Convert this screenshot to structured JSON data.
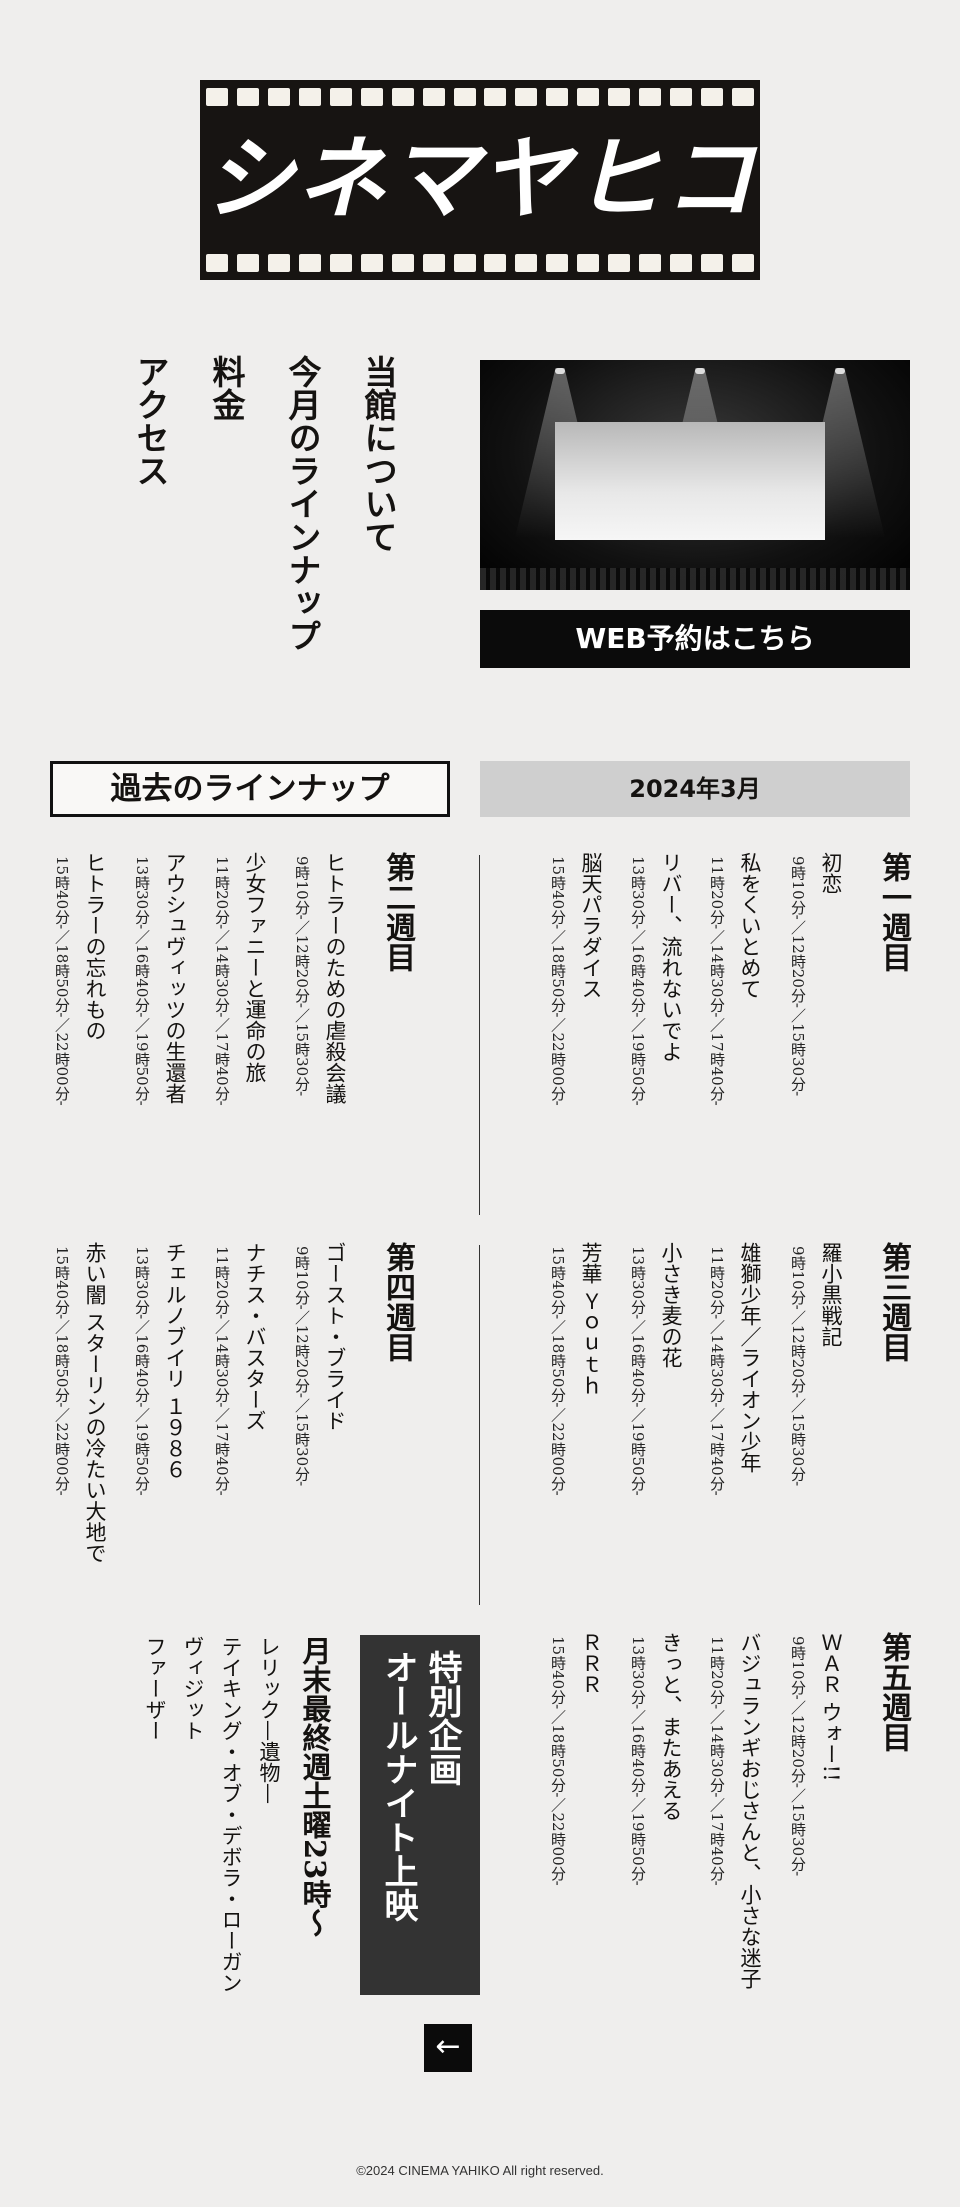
{
  "logo": {
    "text": "シネマヤヒコ"
  },
  "nav": {
    "items": [
      "当館について",
      "今月のラインナップ",
      "料金",
      "アクセス"
    ]
  },
  "reserve": {
    "label": "WEB予約はこちら"
  },
  "lineup": {
    "title": "過去のラインナップ",
    "month": "2024年3月",
    "weeks": [
      {
        "title": "第一週目",
        "films": [
          {
            "title": "初恋",
            "times": "9時10分-／12時20分-／15時30分-"
          },
          {
            "title": "私をくいとめて",
            "times": "11時20分-／14時30分-／17時40分-"
          },
          {
            "title": "リバー、流れないでよ",
            "times": "13時30分-／16時40分-／19時50分-"
          },
          {
            "title": "脳天パラダイス",
            "times": "15時40分-／18時50分-／22時00分-"
          }
        ]
      },
      {
        "title": "第二週目",
        "films": [
          {
            "title": "ヒトラーのための虐殺会議",
            "times": "9時10分-／12時20分-／15時30分-"
          },
          {
            "title": "少女ファニーと運命の旅",
            "times": "11時20分-／14時30分-／17時40分-"
          },
          {
            "title": "アウシュヴィッツの生還者",
            "times": "13時30分-／16時40分-／19時50分-"
          },
          {
            "title": "ヒトラーの忘れもの",
            "times": "15時40分-／18時50分-／22時00分-"
          }
        ]
      },
      {
        "title": "第三週目",
        "films": [
          {
            "title": "羅小黒戦記",
            "times": "9時10分-／12時20分-／15時30分-"
          },
          {
            "title": "雄獅少年／ライオン少年",
            "times": "11時20分-／14時30分-／17時40分-"
          },
          {
            "title": "小さき麦の花",
            "times": "13時30分-／16時40分-／19時50分-"
          },
          {
            "title": "芳華 Ｙｏｕｔｈ",
            "times": "15時40分-／18時50分-／22時00分-"
          }
        ]
      },
      {
        "title": "第四週目",
        "films": [
          {
            "title": "ゴースト・ブライド",
            "times": "9時10分-／12時20分-／15時30分-"
          },
          {
            "title": "ナチス・バスターズ",
            "times": "11時20分-／14時30分-／17時40分-"
          },
          {
            "title": "チェルノブイリ １９８６",
            "times": "13時30分-／16時40分-／19時50分-"
          },
          {
            "title": "赤い闇 スターリンの冷たい大地で",
            "times": "15時40分-／18時50分-／22時00分-"
          }
        ]
      },
      {
        "title": "第五週目",
        "films": [
          {
            "title": "ＷＡＲ ウォー!!",
            "times": "9時10分-／12時20分-／15時30分-"
          },
          {
            "title": "バジュランギおじさんと、小さな迷子",
            "times": "11時20分-／14時30分-／17時40分-"
          },
          {
            "title": "きっと、またあえる",
            "times": "13時30分-／16時40分-／19時50分-"
          },
          {
            "title": "ＲＲＲ",
            "times": "15時40分-／18時50分-／22時00分-"
          }
        ]
      }
    ]
  },
  "special": {
    "box_line1": "特別企画",
    "box_line2": "オールナイト上映",
    "title": "月末最終週土曜23時〜",
    "films": [
      "レリック—遺物—",
      "テイキング・オブ・デボラ・ローガン",
      "ヴィジット",
      "ファーザー"
    ]
  },
  "back": {
    "icon": "arrow-left-icon",
    "glyph": "←"
  },
  "footer": {
    "copyright": "©2024 CINEMA YAHIKO All right reserved."
  }
}
